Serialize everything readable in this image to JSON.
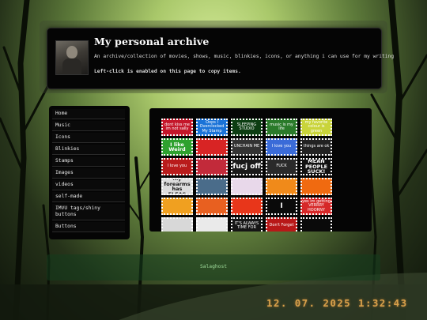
{
  "header": {
    "title": "My personal archive",
    "description": "An archive/collection of movies, shows, music, blinkies, icons, or anything i can use for my writing",
    "note": "Left-click is enabled on this page to copy items."
  },
  "sidebar": {
    "items": [
      {
        "label": "Home"
      },
      {
        "label": "Music"
      },
      {
        "label": "Icons"
      },
      {
        "label": "Blinkies"
      },
      {
        "label": "Stamps"
      },
      {
        "label": "Images"
      },
      {
        "label": "videos"
      },
      {
        "label": "self-made"
      },
      {
        "label": "IMVU tags/shiny buttons"
      },
      {
        "label": "Buttons"
      }
    ]
  },
  "stamps": [
    {
      "text": "dont kiss me im not sally",
      "bg": "#c4162a",
      "size": "small"
    },
    {
      "text": "Oops I Overclocked My Stamp",
      "bg": "#1a73d8",
      "size": "small"
    },
    {
      "text": "SLEEPING STUDIO",
      "bg": "#0c3d12",
      "size": "small"
    },
    {
      "text": "music is my life",
      "bg": "#2a7a2a",
      "size": "small"
    },
    {
      "text": "my favorite colour is green",
      "bg": "#c9d43a",
      "size": "small"
    },
    {
      "text": "I like Weird",
      "bg": "#2ea12e",
      "size": "mid"
    },
    {
      "text": "",
      "bg": "#d82424",
      "size": "small"
    },
    {
      "text": "UNCHAIN ME",
      "bg": "#333333",
      "size": "small"
    },
    {
      "text": "I love you",
      "bg": "#3a6bd8",
      "size": "small"
    },
    {
      "text": "things are ok",
      "bg": "#222222",
      "size": "small"
    },
    {
      "text": "I love you",
      "bg": "#b91c1c",
      "size": "small"
    },
    {
      "text": "",
      "bg": "#c22a3a",
      "size": "small"
    },
    {
      "text": "fucj off",
      "bg": "#1a1a1a",
      "size": "big"
    },
    {
      "text": "FUCK",
      "bg": "#2a2a2a",
      "size": "small"
    },
    {
      "text": "MEAN PEOPLE SUCK!",
      "bg": "#111111",
      "size": "mid"
    },
    {
      "text": "my forearms has FLEAS",
      "bg": "#dcdcdc",
      "size": "mid",
      "color": "#111"
    },
    {
      "text": "",
      "bg": "#4a6c8a",
      "size": "small"
    },
    {
      "text": "",
      "bg": "#e8d8ea",
      "size": "small"
    },
    {
      "text": "",
      "bg": "#f08a1a",
      "size": "small"
    },
    {
      "text": "",
      "bg": "#f06a10",
      "size": "small"
    },
    {
      "text": "",
      "bg": "#f0a020",
      "size": "small"
    },
    {
      "text": "",
      "bg": "#e86020",
      "size": "small"
    },
    {
      "text": "",
      "bg": "#e8361a",
      "size": "small"
    },
    {
      "text": "I",
      "bg": "#0a0a0a",
      "size": "big"
    },
    {
      "text": "yes im getting VERRRY HOORNY",
      "bg": "#d62828",
      "size": "small"
    },
    {
      "text": "",
      "bg": "#d8d8d8",
      "size": "small"
    },
    {
      "text": "",
      "bg": "#eaeaea",
      "size": "small"
    },
    {
      "text": "IT'S ALWAYS TIME FOR",
      "bg": "#151515",
      "size": "small"
    },
    {
      "text": "Don't Forget",
      "bg": "#b81818",
      "size": "small"
    },
    {
      "text": "",
      "bg": "#0a0a0a",
      "size": "small"
    }
  ],
  "footer": {
    "text": "Salaghost"
  },
  "datestamp": "12. 07. 2025   1:32:43"
}
